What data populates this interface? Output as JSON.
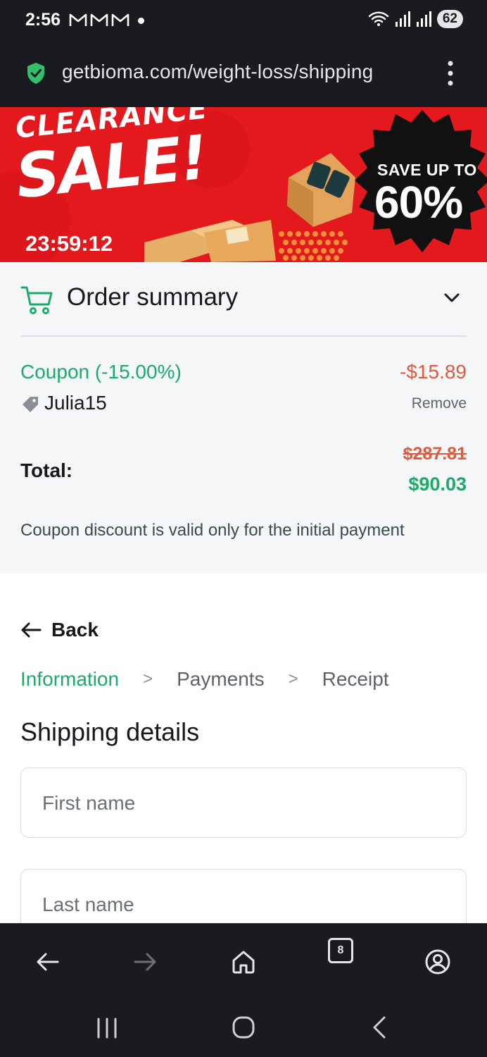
{
  "status_bar": {
    "time": "2:56",
    "battery": "62",
    "notification_icons": [
      "gmail-icon",
      "gmail-icon",
      "gmail-icon"
    ]
  },
  "browser": {
    "url": "getbioma.com/weight-loss/shipping",
    "tab_count": "8"
  },
  "banner": {
    "headline_top": "CLEARANCE",
    "headline_main": "SALE!",
    "timer": "23:59:12",
    "badge_line1": "SAVE UP TO",
    "badge_line2": "60%"
  },
  "order_summary": {
    "title": "Order summary",
    "coupon_label": "Coupon (-15.00%)",
    "coupon_amount": "-$15.89",
    "coupon_code": "Julia15",
    "remove_label": "Remove",
    "total_label": "Total:",
    "total_original": "$287.81",
    "total_final": "$90.03",
    "note": "Coupon discount is valid only for the initial payment"
  },
  "form": {
    "back_label": "Back",
    "steps": [
      "Information",
      "Payments",
      "Receipt"
    ],
    "step_separator": ">",
    "section_title": "Shipping details",
    "first_name_placeholder": "First name",
    "last_name_placeholder": "Last name"
  },
  "colors": {
    "accent_green": "#1aab6b",
    "discount_red": "#e05a3b",
    "banner_red": "#e3191d",
    "chrome_dark": "#1a1b20"
  }
}
